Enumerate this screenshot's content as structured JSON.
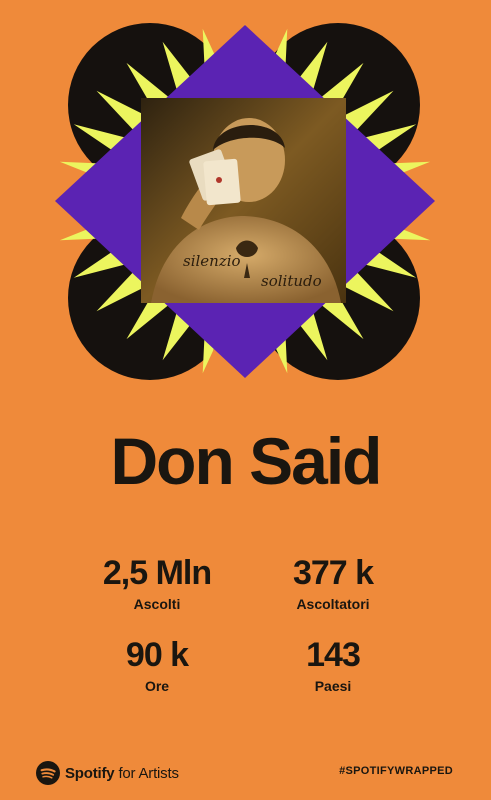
{
  "artist": {
    "name": "Don Said"
  },
  "photo": {
    "tattoo_left": "silenzio",
    "tattoo_right": "solitudo"
  },
  "stats": [
    {
      "value": "2,5 Mln",
      "label": "Ascolti"
    },
    {
      "value": "377 k",
      "label": "Ascoltatori"
    },
    {
      "value": "90 k",
      "label": "Ore"
    },
    {
      "value": "143",
      "label": "Paesi"
    }
  ],
  "footer": {
    "brand_name": "Spotify",
    "brand_suffix": "for Artists",
    "hashtag": "#SPOTIFYWRAPPED"
  },
  "colors": {
    "background": "#ef8a3a",
    "burst_yellow": "#ecf55e",
    "diamond_purple": "#5b23b3",
    "circle_black": "#15110e",
    "text": "#1a1610"
  },
  "icons": [
    "spotify-logo-icon"
  ]
}
